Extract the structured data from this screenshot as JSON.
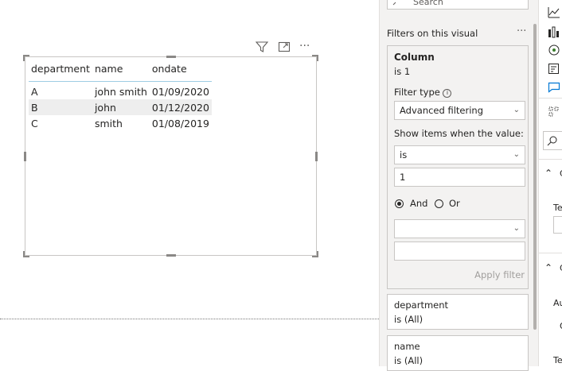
{
  "search": {
    "placeholder": "Search"
  },
  "visual_header": {
    "filter_icon": "filter-icon",
    "focus_icon": "focus-mode-icon",
    "more_label": "···"
  },
  "table": {
    "columns": [
      "department",
      "name",
      "ondate"
    ],
    "rows": [
      [
        "A",
        "john smith",
        "01/09/2020"
      ],
      [
        "B",
        "john",
        "01/12/2020"
      ],
      [
        "C",
        "smith",
        "01/08/2019"
      ]
    ]
  },
  "filters": {
    "section_title": "Filters on this visual",
    "section_more": "···",
    "column_card": {
      "title": "Column",
      "subtitle": "is 1",
      "filter_type_label": "Filter type",
      "filter_type_value": "Advanced filtering",
      "show_items_label": "Show items when the value:",
      "condition1_operator": "is",
      "condition1_value": "1",
      "and_label": "And",
      "or_label": "Or",
      "logic_selected": "And",
      "condition2_operator": "",
      "condition2_value": "",
      "apply_label": "Apply filter"
    },
    "department_card": {
      "title": "department",
      "subtitle": "is (All)"
    },
    "name_card": {
      "title": "name",
      "subtitle": "is (All)"
    }
  },
  "viz_pane": {
    "partial_labels": [
      "Te",
      "Au",
      "Te"
    ],
    "colors": {
      "accent": "#0078d4"
    }
  }
}
